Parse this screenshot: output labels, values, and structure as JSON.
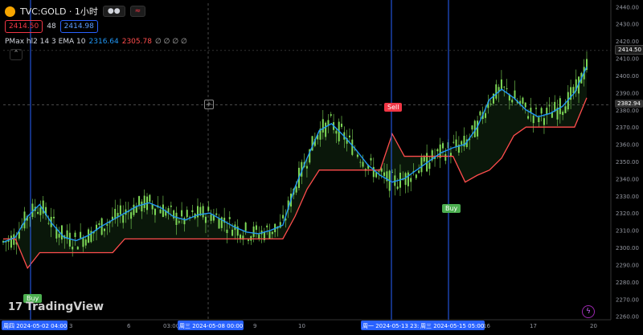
{
  "header": {
    "symbol": "TVC:GOLD · 1小时",
    "approx_icon": "≈",
    "sell_price": "2414.50",
    "spread": "48",
    "buy_price": "2414.98",
    "indicator_name": "PMax hl2 14 3 EMA 10",
    "indicator_val1": "2316.64",
    "indicator_val2": "2305.78",
    "indicator_rest": "∅ ∅ ∅ ∅",
    "collapse_icon": "chevron-up-icon"
  },
  "brand": {
    "logo_text": "TradingView",
    "logo_mark": "17"
  },
  "colors": {
    "bg": "#000000",
    "up": "#26a69a",
    "candle": "#7ed957",
    "ema": "#2196f3",
    "pmax": "#ff4d4d",
    "sell": "#f23645",
    "buy": "#4caf50",
    "vline": "#2962ff"
  },
  "price_tags": {
    "last": "2414.50",
    "cross": "2382.94"
  },
  "signals": [
    {
      "label": "Sell",
      "x_date": "2024-05-13",
      "price": 2373
    },
    {
      "label": "Buy",
      "x_date": "2024-05-15",
      "price": 2318
    },
    {
      "label": "Buy",
      "x_date": "2024-05-02",
      "price": 2272
    }
  ],
  "chart_data": {
    "type": "line",
    "title": "TVC:GOLD · 1小时",
    "y_ticks": [
      "2440.00",
      "2430.00",
      "2420.00",
      "2410.00",
      "2400.00",
      "2390.00",
      "2380.00",
      "2370.00",
      "2360.00",
      "2350.00",
      "2340.00",
      "2330.00",
      "2320.00",
      "2310.00",
      "2300.00",
      "2290.00",
      "2280.00",
      "2270.00",
      "2260.00"
    ],
    "ylim": [
      2258,
      2442
    ],
    "x_ticks": [
      {
        "label": "周四 2024-05-02  04:00",
        "highlight": true
      },
      {
        "label": "3"
      },
      {
        "label": "6"
      },
      {
        "label": "03:00"
      },
      {
        "label": "周三 2024-05-08  00:00",
        "highlight": true
      },
      {
        "label": "9"
      },
      {
        "label": "10"
      },
      {
        "label": "周一 2024-05-13  23:00",
        "highlight": true
      },
      {
        "label": "周三 2024-05-15  05:00",
        "highlight": true
      },
      {
        "label": "16"
      },
      {
        "label": "17"
      },
      {
        "label": "20"
      }
    ],
    "series": [
      {
        "name": "EMA 10",
        "values": [
          2303,
          2306,
          2318,
          2325,
          2314,
          2306,
          2304,
          2307,
          2312,
          2316,
          2320,
          2324,
          2326,
          2323,
          2318,
          2316,
          2319,
          2320,
          2316,
          2312,
          2309,
          2308,
          2310,
          2313,
          2335,
          2352,
          2368,
          2372,
          2365,
          2357,
          2348,
          2342,
          2338,
          2340,
          2345,
          2350,
          2355,
          2358,
          2360,
          2370,
          2386,
          2392,
          2387,
          2380,
          2376,
          2378,
          2382,
          2390,
          2405
        ]
      },
      {
        "name": "PMax",
        "values": [
          2305,
          2305,
          2288,
          2297,
          2297,
          2297,
          2297,
          2297,
          2297,
          2297,
          2305,
          2305,
          2305,
          2305,
          2305,
          2305,
          2305,
          2305,
          2305,
          2305,
          2305,
          2305,
          2305,
          2305,
          2318,
          2334,
          2345,
          2345,
          2345,
          2345,
          2345,
          2345,
          2366,
          2353,
          2353,
          2353,
          2353,
          2353,
          2338,
          2342,
          2345,
          2352,
          2365,
          2370,
          2370,
          2370,
          2370,
          2370,
          2387
        ]
      }
    ]
  }
}
